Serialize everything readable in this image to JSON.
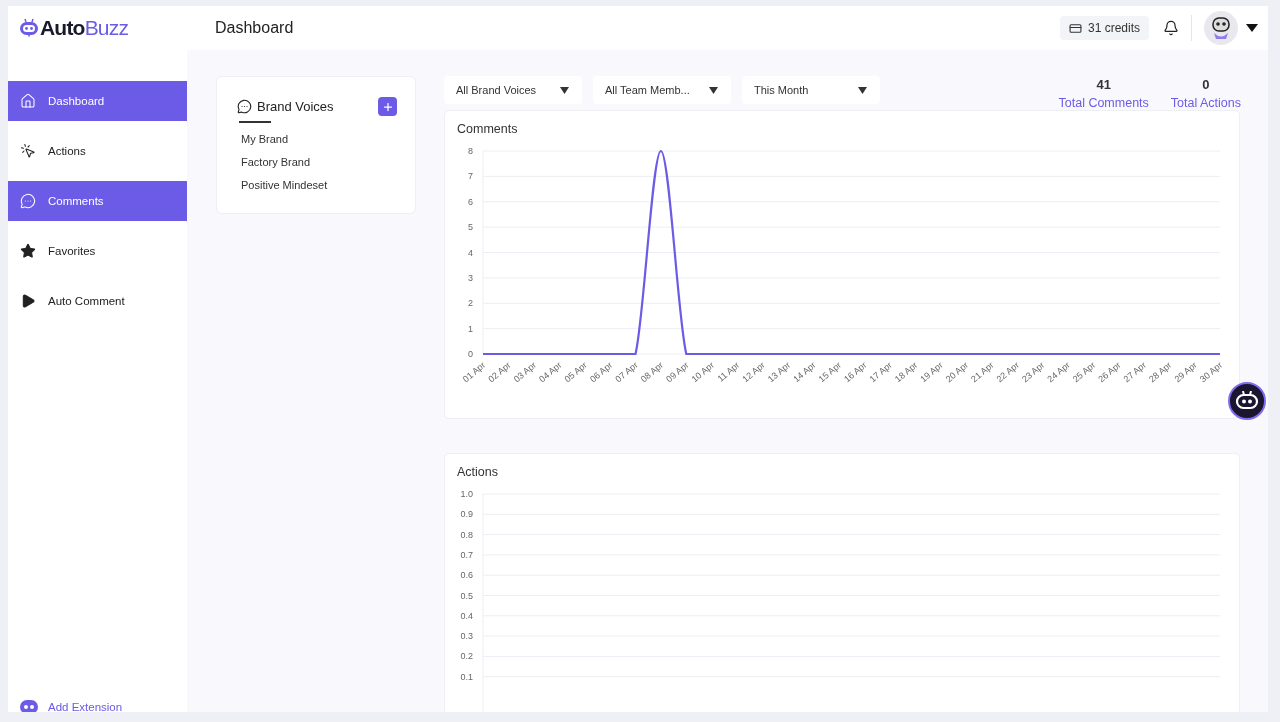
{
  "logo": {
    "primary": "Auto",
    "secondary": "Buzz"
  },
  "header": {
    "title": "Dashboard",
    "credits": "31 credits"
  },
  "sidebar": {
    "items": [
      {
        "label": "Dashboard",
        "selected": true
      },
      {
        "label": "Actions",
        "selected": false
      },
      {
        "label": "Comments",
        "selected": true
      },
      {
        "label": "Favorites",
        "selected": false
      },
      {
        "label": "Auto Comment",
        "selected": false
      }
    ],
    "footer": "Add Extension"
  },
  "brand_voices": {
    "title": "Brand Voices",
    "items": [
      "My Brand",
      "Factory Brand",
      "Positive Mindeset"
    ]
  },
  "filters": [
    "All Brand Voices",
    "All Team Memb...",
    "This Month"
  ],
  "stats": [
    {
      "value": "41",
      "label": "Total Comments"
    },
    {
      "value": "0",
      "label": "Total Actions"
    }
  ],
  "charts": [
    {
      "title": "Comments",
      "chart_data": {
        "type": "line",
        "categories": [
          "01 Apr",
          "02 Apr",
          "03 Apr",
          "04 Apr",
          "05 Apr",
          "06 Apr",
          "07 Apr",
          "08 Apr",
          "09 Apr",
          "10 Apr",
          "11 Apr",
          "12 Apr",
          "13 Apr",
          "14 Apr",
          "15 Apr",
          "16 Apr",
          "17 Apr",
          "18 Apr",
          "19 Apr",
          "20 Apr",
          "21 Apr",
          "22 Apr",
          "23 Apr",
          "24 Apr",
          "25 Apr",
          "26 Apr",
          "27 Apr",
          "28 Apr",
          "29 Apr",
          "30 Apr"
        ],
        "grid": true,
        "series": [
          {
            "color": "#6b5be6",
            "values": [
              0,
              0,
              0,
              0,
              0,
              0,
              0,
              8,
              0,
              0,
              0,
              0,
              0,
              0,
              0,
              0,
              0,
              0,
              0,
              0,
              0,
              0,
              0,
              0,
              0,
              0,
              0,
              0,
              0,
              0
            ]
          }
        ],
        "ylim": [
          0,
          8
        ],
        "yticks": [
          0,
          1,
          2,
          3,
          4,
          5,
          6,
          7,
          8
        ]
      }
    },
    {
      "title": "Actions",
      "axis_labels": [
        "1.0",
        "0.9",
        "0.8",
        "0.7",
        "0.6",
        "0.5",
        "0.4",
        "0.3",
        "0.2",
        "0.1"
      ]
    }
  ]
}
